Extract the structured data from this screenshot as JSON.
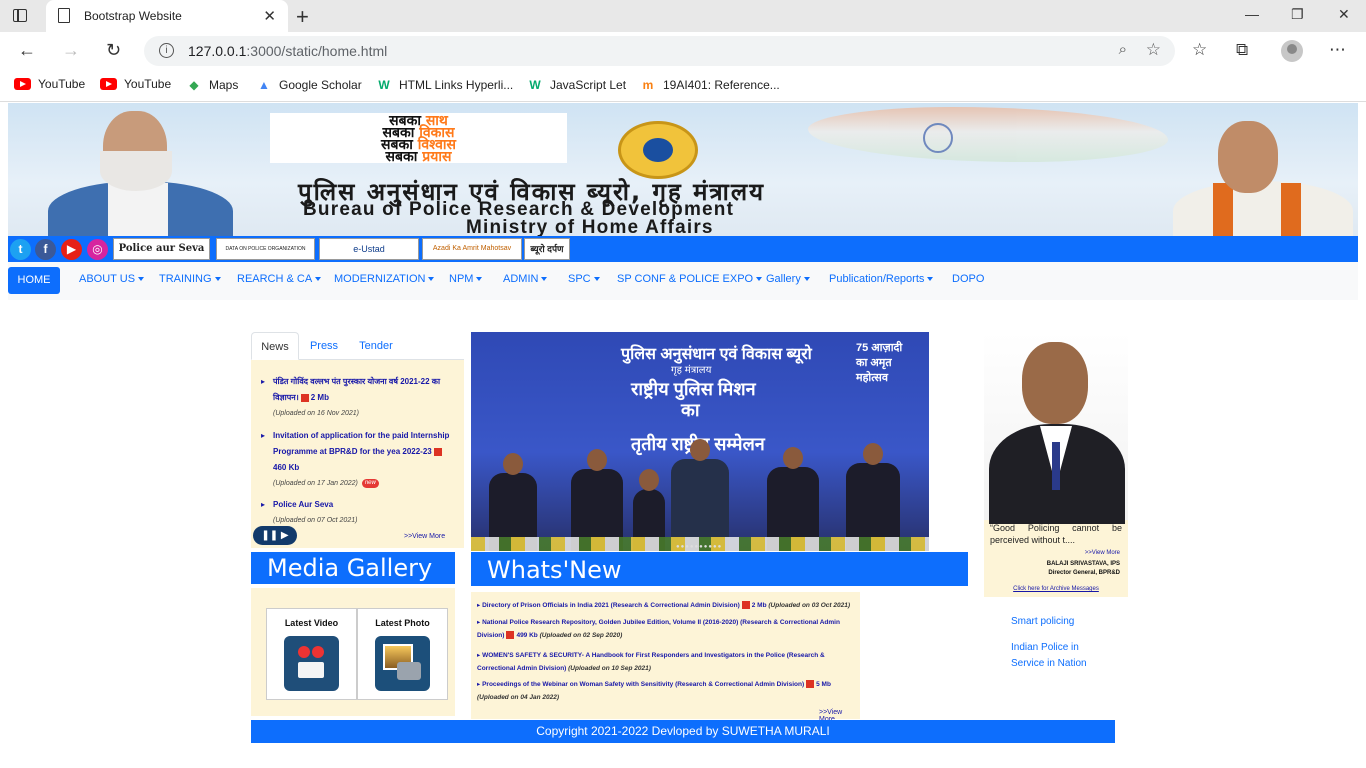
{
  "browser": {
    "tab_title": "Bootstrap Website",
    "url_host": "127.0.0.1",
    "url_rest": ":3000/static/home.html",
    "bookmarks": [
      {
        "label": "YouTube",
        "icon": "youtube-icon"
      },
      {
        "label": "YouTube",
        "icon": "youtube-icon"
      },
      {
        "label": "Maps",
        "icon": "maps-icon"
      },
      {
        "label": "Google Scholar",
        "icon": "scholar-icon"
      },
      {
        "label": "HTML Links Hyperli...",
        "icon": "w3schools-icon"
      },
      {
        "label": "JavaScript Let",
        "icon": "w3schools-icon"
      },
      {
        "label": "19AI401: Reference...",
        "icon": "moodle-icon"
      }
    ]
  },
  "banner": {
    "slogan_1a": "सबका",
    "slogan_1b": "साथ",
    "slogan_2a": "सबका",
    "slogan_2b": "विकास",
    "slogan_3a": "सबका",
    "slogan_3b": "विश्वास",
    "slogan_4a": "सबका",
    "slogan_4b": "प्रयास",
    "emblem_text": "BPRD",
    "hindi_title": "पुलिस अनुसंधान एवं विकास ब्यूरो, गृह मंत्रालय",
    "english_title_1": "Bureau of Police Research & Development",
    "english_title_2": "Ministry of Home Affairs"
  },
  "linkbar": {
    "images": [
      "Police aur Seva",
      "DATA ON POLICE ORGANIZATION",
      "e-Ustad",
      "Azadi Ka Amrit Mahotsav",
      "ब्यूरो दर्पण"
    ]
  },
  "nav": {
    "home": "HOME",
    "items": [
      "ABOUT US",
      "TRAINING",
      "REARCH & CA",
      "MODERNIZATION",
      "NPM",
      "ADMIN",
      "SPC",
      "SP CONF & POLICE EXPO",
      "Gallery",
      "Publication/Reports",
      "DOPO"
    ]
  },
  "news_tabs": [
    "News",
    "Press",
    "Tender"
  ],
  "news": {
    "item1": "पंडित गोविंद वल्लभ पंत पुरस्कार योजना वर्ष 2021-22 का विज्ञापन।",
    "item1_size": "2 Mb",
    "item1_up": "(Uploaded on 16 Nov 2021)",
    "item2": "Invitation of application for the paid Internship Programme at BPR&D for the yea 2022-23",
    "item2_size": "460 Kb",
    "item2_up": "(Uploaded on 17 Jan 2022)",
    "new_badge": "new",
    "item3": "Police Aur Seva",
    "item3_up": "(Uploaded on 07 Oct 2021)",
    "view_more": ">>View More"
  },
  "media_gallery": {
    "heading": "Media Gallery",
    "latest_video": "Latest Video",
    "latest_photo": "Latest Photo"
  },
  "slide": {
    "line1": "पुलिस अनुसंधान एवं विकास ब्यूरो",
    "line2": "गृह मंत्रालय",
    "line3": "राष्ट्रीय पुलिस मिशन",
    "line4": "का",
    "line5": "तृतीय राष्ट्रीय सम्मेलन",
    "amrit": "75 आज़ादी का अमृत महोत्सव"
  },
  "whats_new": {
    "heading": "Whats'New",
    "items": [
      {
        "text": "Directory of Prison Officials in India 2021 (Research & Correctional Admin Division)",
        "size": "2 Mb",
        "up": "(Uploaded on 03 Oct 2021)"
      },
      {
        "text": "National Police Research Repository, Golden Jubilee Edition, Volume II (2016-2020) (Research & Correctional Admin Division)",
        "size": "499 Kb",
        "up": "(Uploaded on 02 Sep 2020)"
      },
      {
        "text": "WOMEN'S SAFETY & SECURITY- A Handbook for First Responders and Investigators in the Police (Research & Correctional Admin Division)",
        "size": "",
        "up": "(Uploaded on 10 Sep 2021)"
      },
      {
        "text": "Proceedings of the Webinar on Woman Safety with Sensitivity (Research & Correctional Admin Division)",
        "size": "5 Mb",
        "up": "(Uploaded on 04 Jan 2022)"
      }
    ],
    "view_more": ">>View More"
  },
  "director": {
    "quote": "“Good Policing cannot be perceived without t....",
    "more": ">>View More",
    "name": "BALAJI SRIVASTAVA, IPS",
    "title": "Director General, BPR&D",
    "archive": "Click here for Archive Messages"
  },
  "side_links": [
    "Smart policing",
    "Indian Police in Service in Nation"
  ],
  "footer": "Copyright 2021-2022 Devloped by SUWETHA MURALI",
  "colors": {
    "primary": "#0d6efd",
    "panel": "#fdf4d7"
  }
}
